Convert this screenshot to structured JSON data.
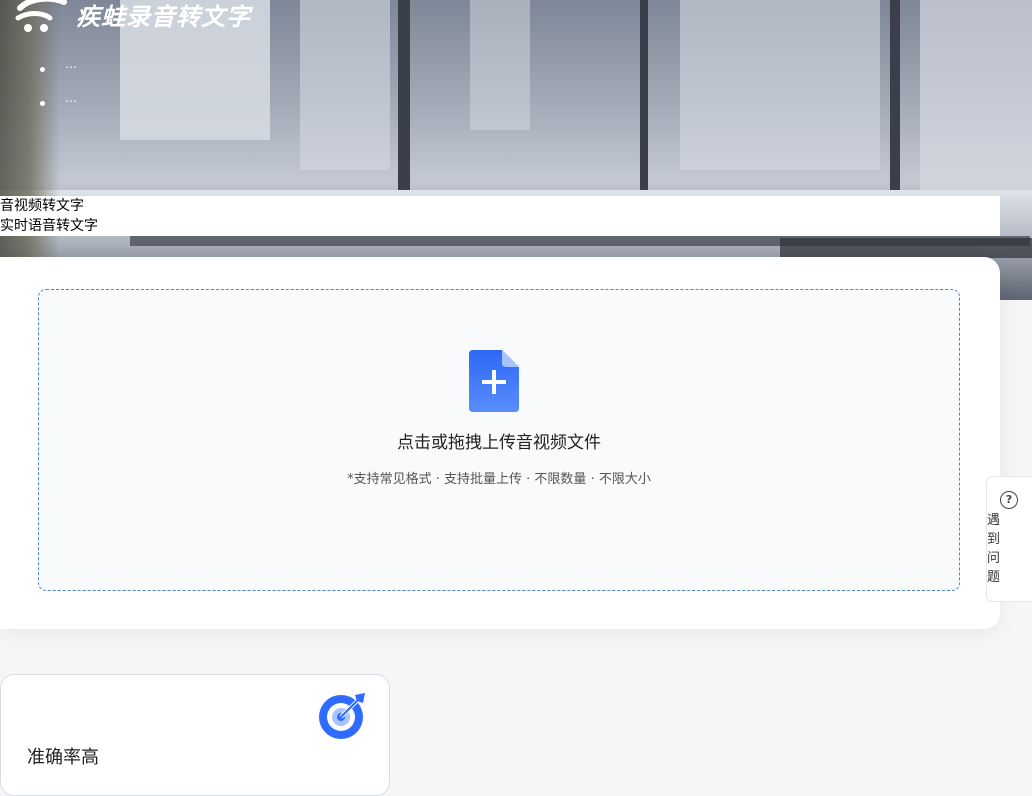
{
  "header": {
    "brand": "疾蛙录音转文字",
    "menu_items": [
      "…",
      "…"
    ]
  },
  "modes": {
    "items": [
      "音视频转文字",
      "实时语音转文字"
    ]
  },
  "upload": {
    "title": "点击或拖拽上传音视频文件",
    "hint": "*支持常见格式 · 支持批量上传 · 不限数量 · 不限大小"
  },
  "help": {
    "label": "遇到问题"
  },
  "features": [
    {
      "title": "准确率高",
      "icon": "target-icon"
    }
  ],
  "colors": {
    "accent": "#2f6bff",
    "dashed_border": "#4a86c8"
  }
}
